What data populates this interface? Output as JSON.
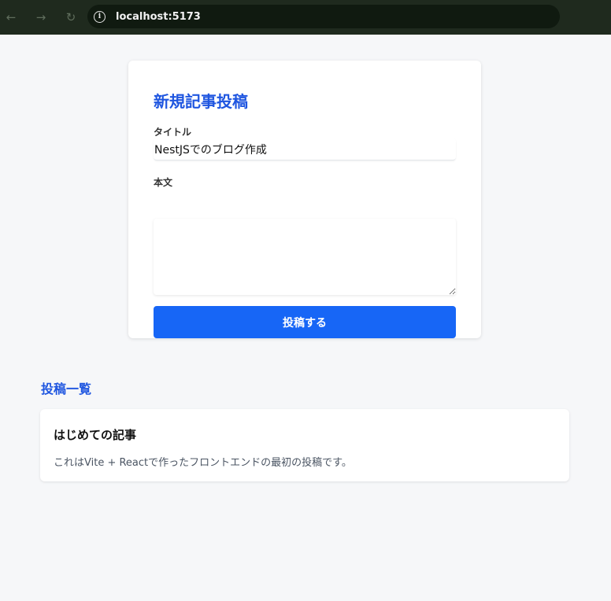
{
  "browser": {
    "url": "localhost:5173",
    "icons": [
      "back-arrow-icon",
      "forward-arrow-icon",
      "reload-icon",
      "info-icon"
    ]
  },
  "form": {
    "title": "新規記事投稿",
    "title_label": "タイトル",
    "title_value": "NestJSでのブログ作成",
    "body_label": "本文",
    "body_value": "",
    "submit_label": "投稿する"
  },
  "list": {
    "heading": "投稿一覧",
    "posts": [
      {
        "title": "はじめての記事",
        "body": "これはVite + Reactで作ったフロントエンドの最初の投稿です。"
      }
    ]
  },
  "colors": {
    "accent": "#1f56e0",
    "button": "#1766f6",
    "page_bg": "#f6f7f9",
    "chrome_bg": "#1f2a1e"
  }
}
